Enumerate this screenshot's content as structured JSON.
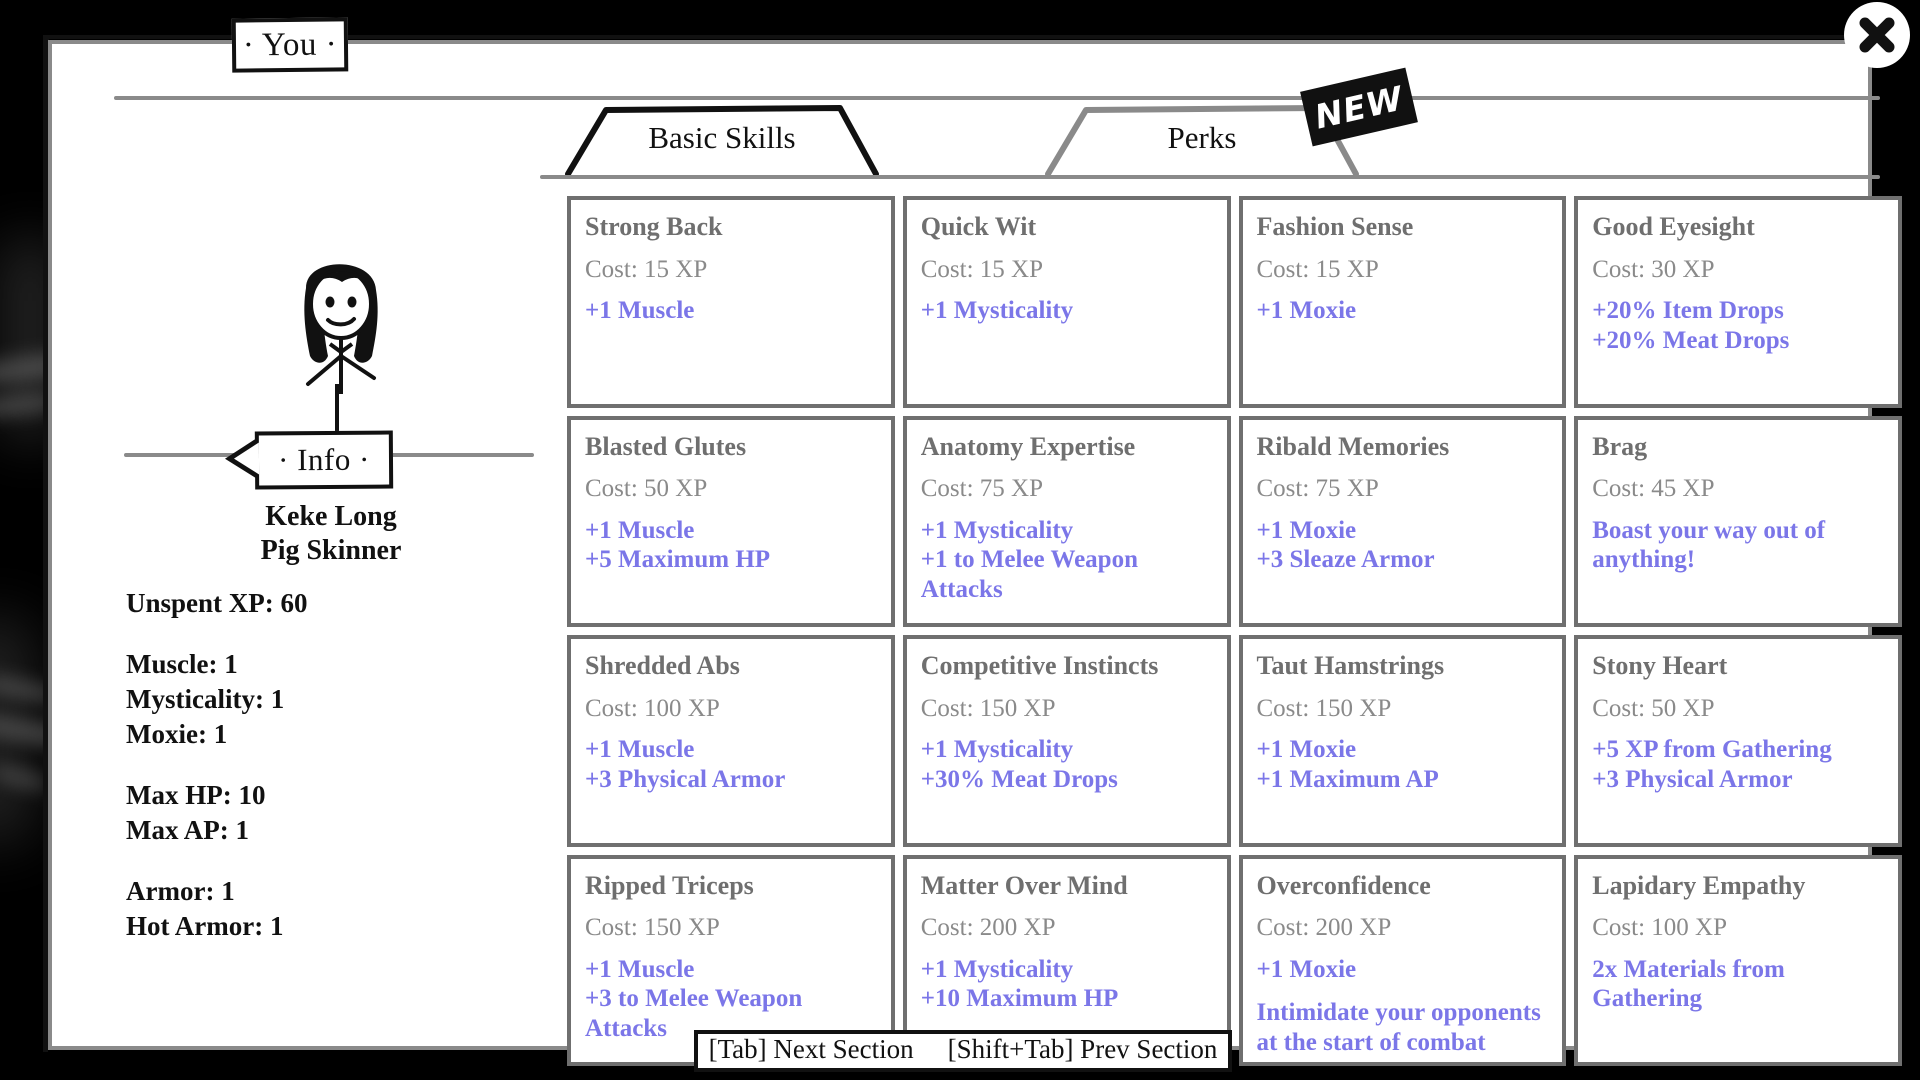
{
  "window": {
    "title_tag": "· You ·",
    "info_tag": "· Info ·",
    "close_icon": "close-icon"
  },
  "character": {
    "name": "Keke Long",
    "class": "Pig Skinner",
    "unspent_xp_label": "Unspent XP: 60",
    "stats_group_1": [
      "Muscle: 1",
      "Mysticality: 1",
      "Moxie: 1"
    ],
    "stats_group_2": [
      "Max HP: 10",
      "Max AP: 1"
    ],
    "stats_group_3": [
      "Armor: 1",
      "Hot Armor: 1"
    ]
  },
  "tabs": [
    {
      "label": "Basic Skills",
      "active": true,
      "badge": null
    },
    {
      "label": "Perks",
      "active": false,
      "badge": "NEW"
    }
  ],
  "colors": {
    "effect_purple": "#7b76e8",
    "card_border_gray": "#6f6f6f",
    "title_gray": "#6f6f6f",
    "cost_gray": "#8a8a8a",
    "frame_gray": "#8a8a8a",
    "ink_black": "#111111"
  },
  "skills": [
    {
      "name": "Strong Back",
      "cost": "Cost: 15 XP",
      "effects": [
        "+1 Muscle"
      ]
    },
    {
      "name": "Quick Wit",
      "cost": "Cost: 15 XP",
      "effects": [
        "+1 Mysticality"
      ]
    },
    {
      "name": "Fashion Sense",
      "cost": "Cost: 15 XP",
      "effects": [
        "+1 Moxie"
      ]
    },
    {
      "name": "Good Eyesight",
      "cost": "Cost: 30 XP",
      "effects": [
        "+20% Item Drops",
        "+20% Meat Drops"
      ]
    },
    {
      "name": "Blasted Glutes",
      "cost": "Cost: 50 XP",
      "effects": [
        "+1 Muscle",
        "+5 Maximum HP"
      ]
    },
    {
      "name": "Anatomy Expertise",
      "cost": "Cost: 75 XP",
      "effects": [
        "+1 Mysticality",
        "+1 to Melee Weapon Attacks"
      ]
    },
    {
      "name": "Ribald Memories",
      "cost": "Cost: 75 XP",
      "effects": [
        "+1 Moxie",
        "+3 Sleaze Armor"
      ]
    },
    {
      "name": "Brag",
      "cost": "Cost: 45 XP",
      "effects": [
        "Boast your way out of anything!"
      ]
    },
    {
      "name": "Shredded Abs",
      "cost": "Cost: 100 XP",
      "effects": [
        "+1 Muscle",
        "+3 Physical Armor"
      ]
    },
    {
      "name": "Competitive Instincts",
      "cost": "Cost: 150 XP",
      "effects": [
        "+1 Mysticality",
        "+30% Meat Drops"
      ]
    },
    {
      "name": "Taut Hamstrings",
      "cost": "Cost: 150 XP",
      "effects": [
        "+1 Moxie",
        "+1 Maximum AP"
      ]
    },
    {
      "name": "Stony Heart",
      "cost": "Cost: 50 XP",
      "effects": [
        "+5 XP from Gathering",
        "+3 Physical Armor"
      ]
    },
    {
      "name": "Ripped Triceps",
      "cost": "Cost: 150 XP",
      "effects": [
        "+1 Muscle",
        "+3 to Melee Weapon Attacks"
      ]
    },
    {
      "name": "Matter Over Mind",
      "cost": "Cost: 200 XP",
      "effects": [
        "+1 Mysticality",
        "+10 Maximum HP"
      ]
    },
    {
      "name": "Overconfidence",
      "cost": "Cost: 200 XP",
      "effects": [
        "+1 Moxie",
        "",
        "Intimidate your opponents at the start of combat"
      ]
    },
    {
      "name": "Lapidary Empathy",
      "cost": "Cost: 100 XP",
      "effects": [
        "2x Materials from Gathering"
      ]
    }
  ],
  "footer": {
    "next_section": "[Tab] Next Section",
    "prev_section": "[Shift+Tab] Prev Section"
  }
}
